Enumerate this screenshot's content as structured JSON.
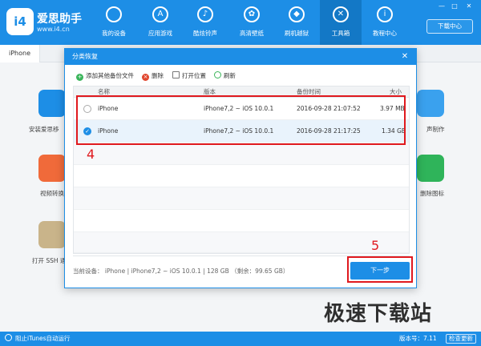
{
  "app": {
    "brand_name": "爱思助手",
    "brand_url": "www.i4.cn",
    "logo_text": "i4"
  },
  "nav": {
    "items": [
      {
        "label": "我的设备",
        "icon": "apple-icon",
        "glyph": ""
      },
      {
        "label": "应用游戏",
        "icon": "app-store-icon",
        "glyph": "A"
      },
      {
        "label": "酷炫铃声",
        "icon": "bell-icon",
        "glyph": "♪"
      },
      {
        "label": "高清壁纸",
        "icon": "flower-icon",
        "glyph": "✿"
      },
      {
        "label": "刷机越狱",
        "icon": "dropbox-icon",
        "glyph": "◆"
      },
      {
        "label": "工具箱",
        "icon": "tools-icon",
        "glyph": "✕"
      },
      {
        "label": "教程中心",
        "icon": "info-icon",
        "glyph": "i"
      }
    ],
    "active_index": 5
  },
  "window": {
    "download_center": "下载中心",
    "minimize": "—",
    "maximize": "□",
    "close": "✕"
  },
  "tabs": {
    "device_tab": "iPhone"
  },
  "background_tiles": {
    "left": [
      "安装爱思移",
      "视频转换",
      "打开 SSH 通"
    ],
    "right": [
      "声制作",
      "删除图标"
    ]
  },
  "dialog": {
    "title": "分类恢复",
    "close": "✕",
    "actions": {
      "add_backup": "添加其他备份文件",
      "delete": "删除",
      "open_location": "打开位置",
      "refresh": "刷新"
    },
    "columns": {
      "name": "名称",
      "version": "版本",
      "backup_time": "备份时间",
      "size": "大小"
    },
    "rows": [
      {
        "name": "iPhone",
        "version": "iPhone7,2 ~ iOS 10.0.1",
        "time": "2016-09-28 21:07:52",
        "size": "3.97 MB",
        "selected": false
      },
      {
        "name": "iPhone",
        "version": "iPhone7,2 ~ iOS 10.0.1",
        "time": "2016-09-28 21:17:25",
        "size": "1.34 GB",
        "selected": true
      }
    ],
    "device_info": "当前设备： iPhone  |  iPhone7,2 ~ iOS 10.0.1  |  128 GB （剩余：99.65 GB）",
    "next_button": "下一步",
    "check_mark": "✓"
  },
  "annotations": {
    "step_rows": "4",
    "step_next": "5"
  },
  "statusbar": {
    "block_itunes": "阻止iTunes自动运行",
    "version": "版本号：7.11",
    "check_update": "检查更新"
  },
  "watermark": "极速下载站",
  "colors": {
    "primary": "#1d8ee6",
    "highlight": "#e0191e"
  }
}
